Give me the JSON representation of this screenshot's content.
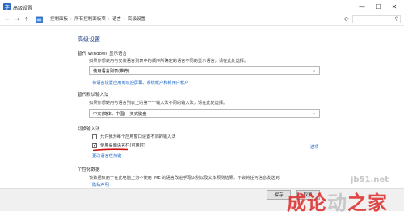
{
  "window": {
    "title": "高级设置"
  },
  "window_controls": {
    "minimize": "—",
    "maximize": "☐",
    "close": "✕"
  },
  "nav": {
    "back": "←",
    "forward": "→",
    "up": "↑"
  },
  "breadcrumb": [
    "控制面板",
    "所有控制面板项",
    "语言",
    "高级设置"
  ],
  "search": {
    "placeholder": ""
  },
  "page": {
    "heading": "高级设置",
    "override_display": {
      "title": "替代 Windows 显示语言",
      "desc": "如果你想使用与安装语言列表中的顺序所确定的语言不同的显示语言，请在此处选择。",
      "dropdown_value": "使用语言列表(推荐)",
      "link": "将语言设置应用到欢迎屏幕、系统帐户和新用户帐户"
    },
    "override_input": {
      "title": "替代默认输入法",
      "desc": "如果你想使用与语言列表上的第一个输入法不同的输入法，请在此处选择。",
      "dropdown_value": "中文(简体，中国) - 美式键盘"
    },
    "switch_input": {
      "title": "切换输入法",
      "option1": "允许我为每个应用窗口设置不同的输入法",
      "option1_checked": false,
      "option2": "使用桌面语言栏(可用时)",
      "option2_checked": true,
      "options_link": "选项",
      "hotkey_link": "更改语言栏热键"
    },
    "personalization": {
      "title": "个性化数据",
      "desc": "该数据仅用于在此电脑上为不使用 IME 的语言改进手写识别以及文本预测结果。不会将任何信息发送到",
      "privacy_link": "隐私声明"
    }
  },
  "buttons": {
    "save": "保存",
    "cancel": "取消"
  },
  "watermark": {
    "site": "jb51.net",
    "text_main": "成论",
    "text_faint": "动",
    "text_tail": "之家"
  },
  "colors": {
    "heading": "#1e3e8a",
    "link": "#1a64c8",
    "annotation": "#cc1111"
  }
}
